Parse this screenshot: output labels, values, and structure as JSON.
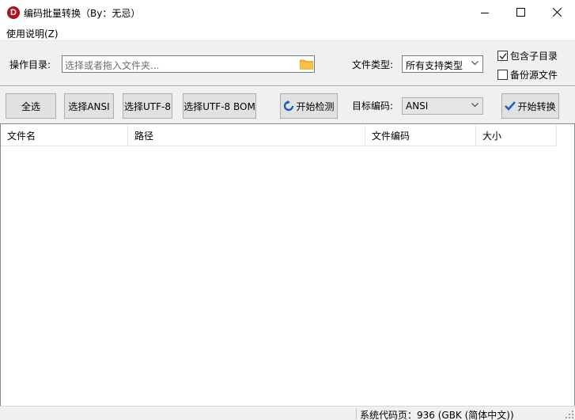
{
  "window": {
    "title": "编码批量转换（By：无忌）",
    "app_icon_letter": "D",
    "controls": [
      "minimize-icon",
      "maximize-icon",
      "close-icon"
    ]
  },
  "menu": {
    "help_label": "使用说明(Z)"
  },
  "options": {
    "directory_label": "操作目录:",
    "directory_placeholder": "选择或者拖入文件夹...",
    "filetype_label": "文件类型:",
    "filetype_value": "所有支持类型",
    "include_subdirs_label": "包含子目录",
    "include_subdirs_checked": true,
    "backup_source_label": "备份源文件",
    "backup_source_checked": false
  },
  "toolbar": {
    "select_all_label": "全选",
    "select_ansi_label": "选择ANSI",
    "select_utf8_label": "选择UTF-8",
    "select_utf8bom_label": "选择UTF-8 BOM",
    "start_detect_label": "开始检测",
    "target_encoding_label": "目标编码:",
    "target_encoding_value": "ANSI",
    "start_convert_label": "开始转换"
  },
  "table": {
    "columns": [
      "文件名",
      "路径",
      "文件编码",
      "大小"
    ],
    "rows": []
  },
  "status": {
    "codepage_text": "系统代码页：936 (GBK (简体中文))"
  },
  "colors": {
    "app_icon_red": "#b0101a",
    "folder_orange": "#f3b32a",
    "check_blue": "#1f5fbf"
  }
}
